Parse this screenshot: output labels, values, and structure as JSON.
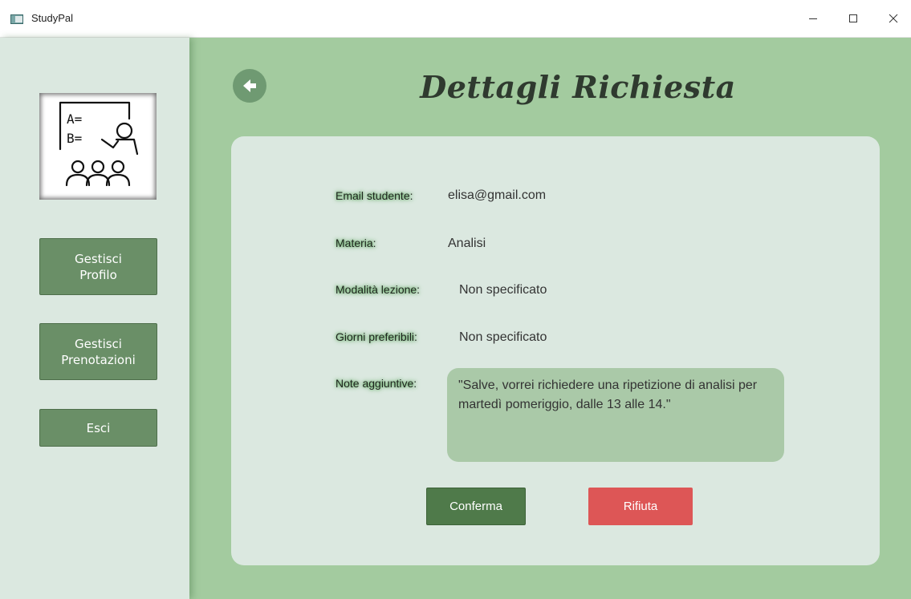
{
  "window": {
    "title": "StudyPal",
    "minimize_icon": "minimize-icon",
    "maximize_icon": "maximize-icon",
    "close_icon": "close-icon"
  },
  "sidebar": {
    "logo_icon": "teacher-classroom-icon",
    "logo_text_a": "A=",
    "logo_text_b": "B=",
    "buttons": [
      {
        "label_line1": "Gestisci",
        "label_line2": "Profilo"
      },
      {
        "label_line1": "Gestisci",
        "label_line2": "Prenotazioni"
      },
      {
        "label": "Esci"
      }
    ]
  },
  "header": {
    "back_icon": "arrow-left-icon",
    "title": "Dettagli Richiesta"
  },
  "details": {
    "email_label": "Email studente:",
    "email_value": "elisa@gmail.com",
    "subject_label": "Materia:",
    "subject_value": "Analisi",
    "mode_label": "Modalità lezione:",
    "mode_value": "Non specificato",
    "days_label": "Giorni preferibili:",
    "days_value": "Non specificato",
    "notes_label": "Note aggiuntive:",
    "notes_value": "\"Salve, vorrei richiedere una ripetizione di analisi per martedì pomeriggio, dalle 13 alle 14.\""
  },
  "actions": {
    "confirm_label": "Conferma",
    "reject_label": "Rifiuta"
  },
  "colors": {
    "background": "#a3cb9f",
    "sidebar": "#dbe8e0",
    "card": "#dbe8e0",
    "primary_button": "#6a8f67",
    "confirm": "#4f7a4a",
    "reject": "#dd5656"
  }
}
